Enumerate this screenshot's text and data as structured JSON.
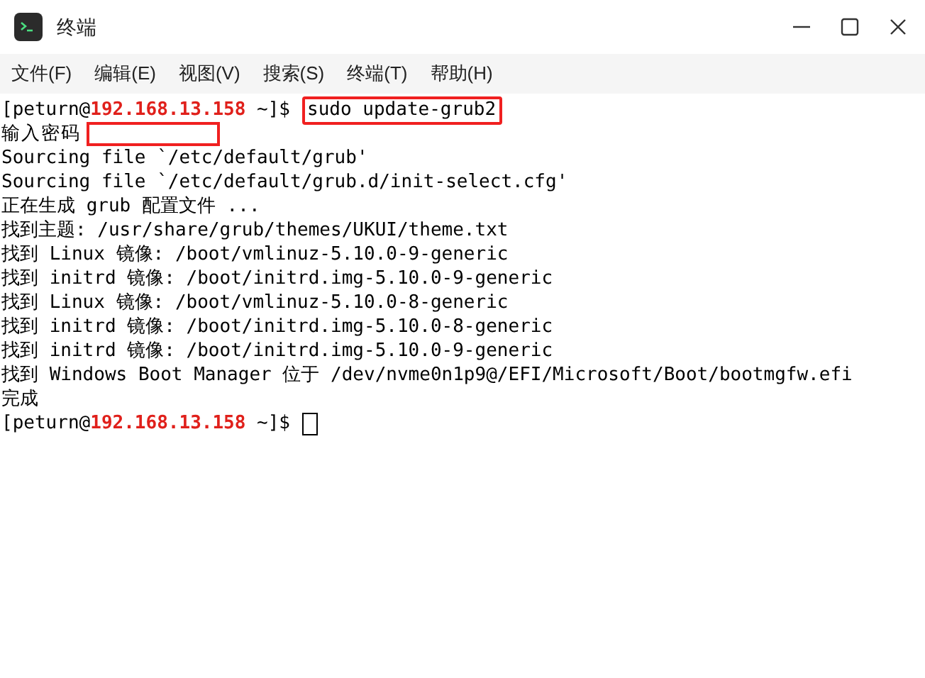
{
  "window": {
    "title": "终端"
  },
  "menu": [
    "文件(F)",
    "编辑(E)",
    "视图(V)",
    "搜索(S)",
    "终端(T)",
    "帮助(H)"
  ],
  "terminal": {
    "lines": [
      {
        "kind": "prompt",
        "user": "[peturn@",
        "host": "192.168.13.158",
        "path": " ~]$",
        "command": "sudo update-grub2",
        "highlighted": true,
        "cursor": false
      },
      {
        "kind": "password",
        "text": "输入密码",
        "highlighted": true
      },
      {
        "kind": "output",
        "text": "Sourcing file `/etc/default/grub'"
      },
      {
        "kind": "output",
        "text": "Sourcing file `/etc/default/grub.d/init-select.cfg'"
      },
      {
        "kind": "output",
        "text": "正在生成 grub 配置文件 ..."
      },
      {
        "kind": "output",
        "text": "找到主题: /usr/share/grub/themes/UKUI/theme.txt"
      },
      {
        "kind": "output",
        "text": "找到 Linux 镜像: /boot/vmlinuz-5.10.0-9-generic"
      },
      {
        "kind": "output",
        "text": "找到 initrd 镜像: /boot/initrd.img-5.10.0-9-generic"
      },
      {
        "kind": "output",
        "text": "找到 Linux 镜像: /boot/vmlinuz-5.10.0-8-generic"
      },
      {
        "kind": "output",
        "text": "找到 initrd 镜像: /boot/initrd.img-5.10.0-8-generic"
      },
      {
        "kind": "output",
        "text": "找到 initrd 镜像: /boot/initrd.img-5.10.0-9-generic"
      },
      {
        "kind": "output",
        "text": "找到 Windows Boot Manager 位于 /dev/nvme0n1p9@/EFI/Microsoft/Boot/bootmgfw.efi"
      },
      {
        "kind": "output",
        "text": "完成"
      },
      {
        "kind": "prompt",
        "user": "[peturn@",
        "host": "192.168.13.158",
        "path": " ~]$",
        "cursor": true
      }
    ]
  }
}
